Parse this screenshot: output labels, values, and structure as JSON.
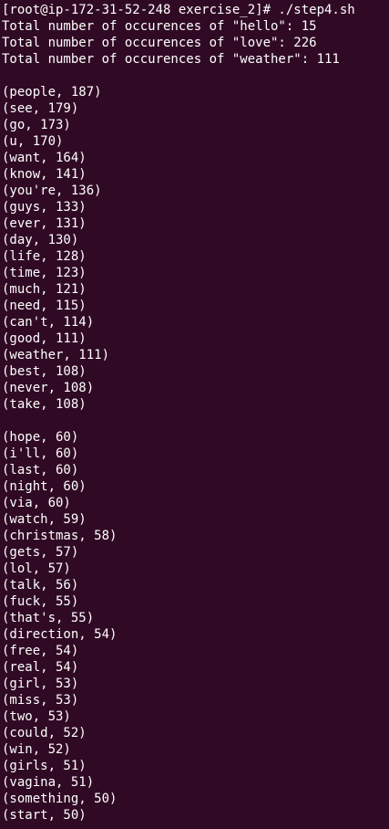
{
  "terminal": {
    "prompt_line": "[root@ip-172-31-52-248 exercise_2]# ./step4.sh",
    "totals": [
      "Total number of occurences of \"hello\": 15",
      "Total number of occurences of \"love\": 226",
      "Total number of occurences of \"weather\": 111"
    ],
    "top_words": [
      "(people, 187)",
      "(see, 179)",
      "(go, 173)",
      "(u, 170)",
      "(want, 164)",
      "(know, 141)",
      "(you're, 136)",
      "(guys, 133)",
      "(ever, 131)",
      "(day, 130)",
      "(life, 128)",
      "(time, 123)",
      "(much, 121)",
      "(need, 115)",
      "(can't, 114)",
      "(good, 111)",
      "(weather, 111)",
      "(best, 108)",
      "(never, 108)",
      "(take, 108)"
    ],
    "second_words": [
      "(hope, 60)",
      "(i'll, 60)",
      "(last, 60)",
      "(night, 60)",
      "(via, 60)",
      "(watch, 59)",
      "(christmas, 58)",
      "(gets, 57)",
      "(lol, 57)",
      "(talk, 56)",
      "(fuck, 55)",
      "(that's, 55)",
      "(direction, 54)",
      "(free, 54)",
      "(real, 54)",
      "(girl, 53)",
      "(miss, 53)",
      "(two, 53)",
      "(could, 52)",
      "(win, 52)",
      "(girls, 51)",
      "(vagina, 51)",
      "(something, 50)",
      "(start, 50)"
    ],
    "background": "#300a24",
    "foreground": "#ffffff"
  }
}
